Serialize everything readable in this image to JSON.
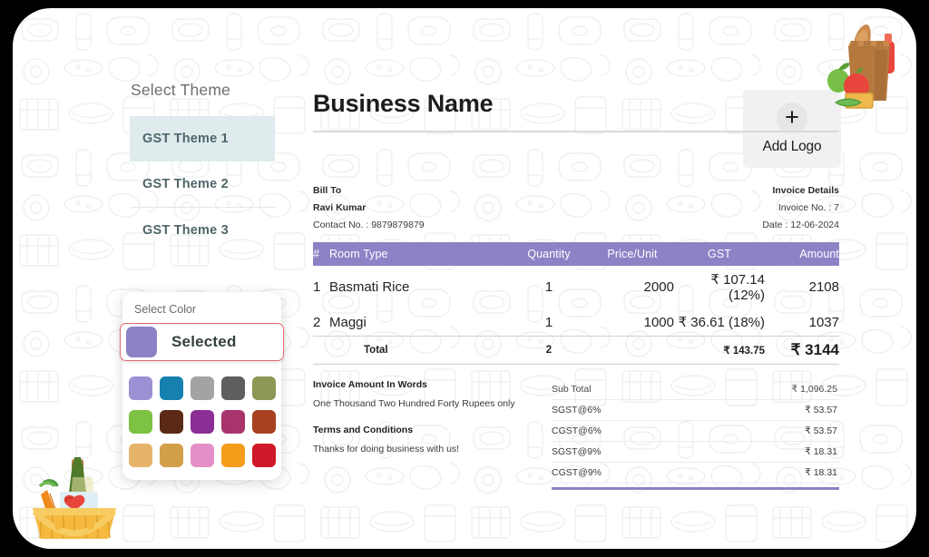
{
  "theme_panel": {
    "title": "Select Theme",
    "items": [
      {
        "label": "GST Theme 1",
        "selected": true
      },
      {
        "label": "GST Theme 2",
        "selected": false
      },
      {
        "label": "GST Theme 3",
        "selected": false
      }
    ]
  },
  "color_panel": {
    "label": "Select Color",
    "selected_label": "Selected",
    "selected_color": "#8d82c6",
    "highlight_border": "#e36a72",
    "swatches": [
      "#9b90d4",
      "#1680ae",
      "#a3a3a3",
      "#5f5f5f",
      "#8d9654",
      "#7dc242",
      "#5a2a16",
      "#8b2f96",
      "#a8346c",
      "#a9401f",
      "#e5b46a",
      "#d2a04a",
      "#e58fc8",
      "#f59c1a",
      "#cf1928"
    ]
  },
  "invoice": {
    "business_name": "Business Name",
    "add_logo": {
      "label": "Add Logo",
      "icon": "plus-icon"
    },
    "bill_to": {
      "title": "Bill To",
      "customer_name": "Ravi Kumar",
      "contact": "Contact No. : 9879879879"
    },
    "invoice_details": {
      "title": "Invoice Details",
      "invoice_no": "Invoice No. : 7",
      "date": "Date : 12-06-2024"
    },
    "table": {
      "headers": {
        "index": "#",
        "description": "Room Type",
        "quantity": "Quantity",
        "price_unit": "Price/Unit",
        "gst": "GST",
        "amount": "Amount"
      },
      "header_color": "#8d82c6",
      "rows": [
        {
          "index": "1",
          "description": "Basmati Rice",
          "quantity": "1",
          "price_unit": "2000",
          "gst": "₹ 107.14 (12%)",
          "amount": "2108"
        },
        {
          "index": "2",
          "description": "Maggi",
          "quantity": "1",
          "price_unit": "1000",
          "gst": "₹ 36.61 (18%)",
          "amount": "1037"
        }
      ],
      "total": {
        "label": "Total",
        "quantity": "2",
        "gst": "₹ 143.75",
        "amount": "₹ 3144"
      }
    },
    "words": {
      "title": "Invoice Amount In Words",
      "body": "One Thousand Two Hundred Forty Rupees only"
    },
    "terms": {
      "title": "Terms and Conditions",
      "body": "Thanks for doing business with us!"
    },
    "summary": [
      {
        "label": "Sub Total",
        "value": "₹ 1,096.25"
      },
      {
        "label": "SGST@6%",
        "value": "₹ 53.57"
      },
      {
        "label": "CGST@6%",
        "value": "₹ 53.57"
      },
      {
        "label": "SGST@9%",
        "value": "₹ 18.31"
      },
      {
        "label": "CGST@9%",
        "value": "₹ 18.31"
      }
    ]
  },
  "decorations": {
    "top_right_icon": "grocery-bag-illustration",
    "bottom_left_icon": "grocery-basket-illustration",
    "background": "grocery-doodle-pattern"
  }
}
